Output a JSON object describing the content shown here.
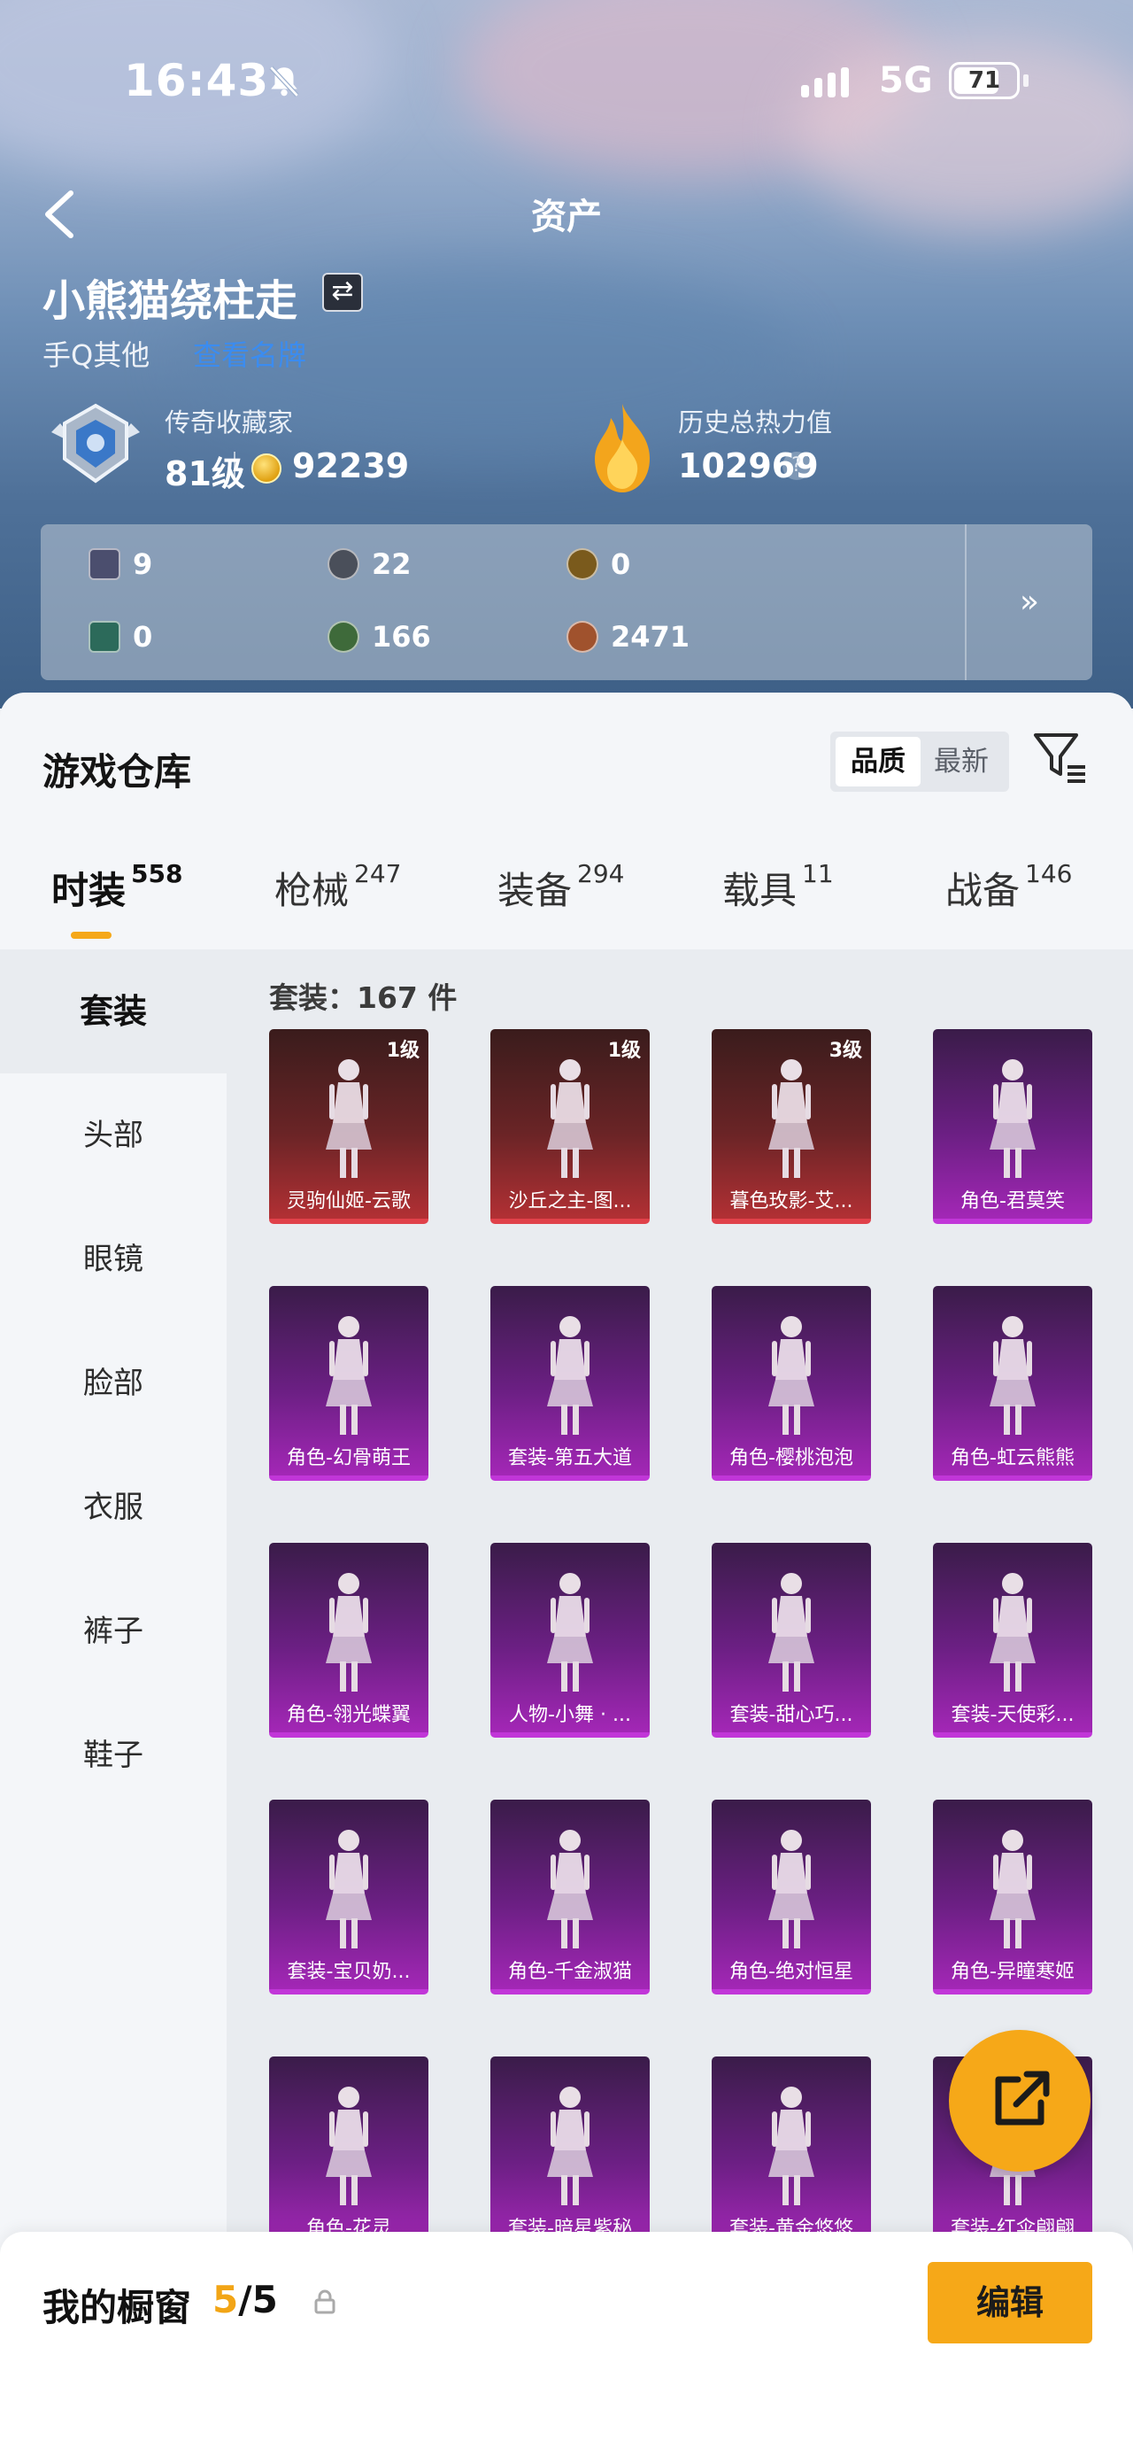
{
  "status_bar": {
    "time": "16:43",
    "network": "5G",
    "battery": "71",
    "battery_level": 0.71
  },
  "nav": {
    "title": "资产"
  },
  "profile": {
    "username": "小熊猫绕柱走",
    "platform": "手Q其他",
    "platform_link": "查看名牌",
    "collector_label": "传奇收藏家",
    "collector_level": "81级",
    "coin_value": "92239",
    "heat_label": "历史总热力值",
    "heat_value": "102969",
    "help_glyph": "?"
  },
  "assets": [
    {
      "icon": "card-icon",
      "value": "9",
      "color": "#4b4e6e"
    },
    {
      "icon": "silver-coin-icon",
      "value": "22",
      "color": "#4a4f5a"
    },
    {
      "icon": "gold-coin-icon",
      "value": "0",
      "color": "#7a5a1c"
    },
    {
      "icon": "green-card-icon",
      "value": "0",
      "color": "#2c6a5a"
    },
    {
      "icon": "green-orb-icon",
      "value": "166",
      "color": "#3e6a3a"
    },
    {
      "icon": "bronze-coin-icon",
      "value": "2471",
      "color": "#a0522d"
    }
  ],
  "asset_more_glyph": "»",
  "warehouse": {
    "title": "游戏仓库",
    "sort_options": [
      "品质",
      "最新"
    ],
    "tabs": [
      {
        "label": "时装",
        "count": "558"
      },
      {
        "label": "枪械",
        "count": "247"
      },
      {
        "label": "装备",
        "count": "294"
      },
      {
        "label": "载具",
        "count": "11"
      },
      {
        "label": "战备",
        "count": "146"
      }
    ],
    "sidebar": [
      "套装",
      "头部",
      "眼镜",
      "脸部",
      "衣服",
      "裤子",
      "鞋子"
    ],
    "count_line": "套装：167 件",
    "items": [
      {
        "name": "灵驹仙姬-云歌",
        "level": "1级",
        "rarity": "red"
      },
      {
        "name": "沙丘之主-图...",
        "level": "1级",
        "rarity": "red"
      },
      {
        "name": "暮色玫影-艾...",
        "level": "3级",
        "rarity": "red"
      },
      {
        "name": "角色-君莫笑",
        "level": "",
        "rarity": "purple"
      },
      {
        "name": "角色-幻骨萌王",
        "level": "",
        "rarity": "purple"
      },
      {
        "name": "套装-第五大道",
        "level": "",
        "rarity": "purple"
      },
      {
        "name": "角色-樱桃泡泡",
        "level": "",
        "rarity": "purple"
      },
      {
        "name": "角色-虹云熊熊",
        "level": "",
        "rarity": "purple"
      },
      {
        "name": "角色-翎光蝶翼",
        "level": "",
        "rarity": "purple"
      },
      {
        "name": "人物-小舞 · ...",
        "level": "",
        "rarity": "purple"
      },
      {
        "name": "套装-甜心巧...",
        "level": "",
        "rarity": "purple"
      },
      {
        "name": "套装-天使彩...",
        "level": "",
        "rarity": "purple"
      },
      {
        "name": "套装-宝贝奶...",
        "level": "",
        "rarity": "purple"
      },
      {
        "name": "角色-千金淑猫",
        "level": "",
        "rarity": "purple"
      },
      {
        "name": "角色-绝对恒星",
        "level": "",
        "rarity": "purple"
      },
      {
        "name": "角色-异瞳寒姬",
        "level": "",
        "rarity": "purple"
      },
      {
        "name": "角色-花灵",
        "level": "",
        "rarity": "purple"
      },
      {
        "name": "套装-暗星紫秘",
        "level": "",
        "rarity": "purple"
      },
      {
        "name": "套装-黄金悠悠",
        "level": "",
        "rarity": "purple"
      },
      {
        "name": "套装-红伞翩翩",
        "level": "",
        "rarity": "purple"
      }
    ]
  },
  "showcase": {
    "title": "我的橱窗",
    "current": "5",
    "total": "/5",
    "edit_label": "编辑"
  },
  "colors": {
    "accent": "#f6a818",
    "red_rarity": "#e0414a",
    "purple_rarity": "#c136d8",
    "link": "#3b8cf0"
  }
}
